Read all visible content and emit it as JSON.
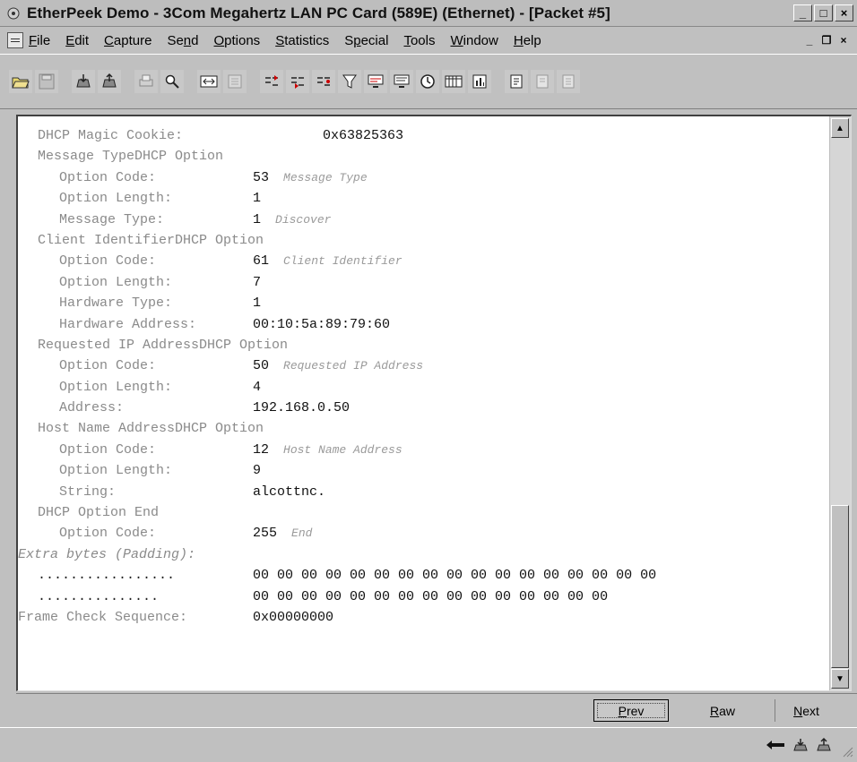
{
  "window": {
    "title": "EtherPeek Demo - 3Com Megahertz LAN PC Card (589E) (Ethernet) - [Packet #5]",
    "minimize": "_",
    "maximize": "□",
    "close": "×",
    "mdi_minimize": "_",
    "mdi_restore": "❐",
    "mdi_close": "×"
  },
  "menu": [
    {
      "pre": "",
      "u": "F",
      "post": "ile"
    },
    {
      "pre": "",
      "u": "E",
      "post": "dit"
    },
    {
      "pre": "",
      "u": "C",
      "post": "apture"
    },
    {
      "pre": "Se",
      "u": "n",
      "post": "d"
    },
    {
      "pre": "",
      "u": "O",
      "post": "ptions"
    },
    {
      "pre": "",
      "u": "S",
      "post": "tatistics"
    },
    {
      "pre": "S",
      "u": "p",
      "post": "ecial"
    },
    {
      "pre": "",
      "u": "T",
      "post": "ools"
    },
    {
      "pre": "",
      "u": "W",
      "post": "indow"
    },
    {
      "pre": "",
      "u": "H",
      "post": "elp"
    }
  ],
  "toolbar": {
    "buttons": [
      "open-icon",
      "save-icon",
      "capture-start-icon",
      "capture-stop-icon",
      "print-icon",
      "find-icon",
      "network-icon",
      "disabled-icon",
      "node-stats-icon",
      "protocol-stats-icon",
      "conversation-icon",
      "filter-icon",
      "monitor-icon",
      "monitor-2-icon",
      "clock-icon",
      "table-icon",
      "chart-icon",
      "document-icon",
      "disabled-doc-icon",
      "disabled-doc-2-icon"
    ]
  },
  "packet": {
    "lines": [
      {
        "indent": 1,
        "label": "DHCP Magic Cookie:",
        "value": "0x63825363",
        "value_offset": true
      },
      {
        "indent": 1,
        "label": "Message TypeDHCP Option"
      },
      {
        "indent": 2,
        "label": "Option Code:",
        "value": "53",
        "note": "Message Type"
      },
      {
        "indent": 2,
        "label": "Option Length:",
        "value": "1"
      },
      {
        "indent": 2,
        "label": "Message Type:",
        "value": "1",
        "note": "Discover"
      },
      {
        "indent": 1,
        "label": "Client IdentifierDHCP Option"
      },
      {
        "indent": 2,
        "label": "Option Code:",
        "value": "61",
        "note": "Client Identifier"
      },
      {
        "indent": 2,
        "label": "Option Length:",
        "value": "7"
      },
      {
        "indent": 2,
        "label": "Hardware Type:",
        "value": "1"
      },
      {
        "indent": 2,
        "label": "Hardware Address:",
        "value": "00:10:5a:89:79:60"
      },
      {
        "indent": 1,
        "label": "Requested IP AddressDHCP Option"
      },
      {
        "indent": 2,
        "label": "Option Code:",
        "value": "50",
        "note": "Requested IP Address"
      },
      {
        "indent": 2,
        "label": "Option Length:",
        "value": "4"
      },
      {
        "indent": 2,
        "label": "Address:",
        "value": "192.168.0.50"
      },
      {
        "indent": 1,
        "label": "Host Name AddressDHCP Option"
      },
      {
        "indent": 2,
        "label": "Option Code:",
        "value": "12",
        "note": "Host Name Address"
      },
      {
        "indent": 2,
        "label": "Option Length:",
        "value": "9"
      },
      {
        "indent": 2,
        "label": "String:",
        "value": "alcottnc."
      },
      {
        "indent": 1,
        "label": "DHCP Option End"
      },
      {
        "indent": 2,
        "label": "Option Code:",
        "value": "255",
        "note": "End"
      },
      {
        "indent": 0,
        "label": "Extra bytes (Padding):",
        "italic": true
      },
      {
        "indent": 1,
        "label": ".................",
        "value": "00 00 00 00 00 00 00 00 00 00 00 00 00 00 00 00 00",
        "dark": true
      },
      {
        "indent": 1,
        "label": "...............",
        "value": "00 00 00 00 00 00 00 00 00 00 00 00 00 00 00",
        "dark": true
      },
      {
        "indent": 0,
        "label": "Frame Check Sequence:",
        "value": "0x00000000"
      }
    ]
  },
  "nav": {
    "prev_u": "P",
    "prev_rest": "rev",
    "raw_u": "R",
    "raw_rest": "aw",
    "next_u": "N",
    "next_rest": "ext"
  },
  "scrollbar": {
    "up": "▲",
    "down": "▼",
    "position": 0.72
  }
}
